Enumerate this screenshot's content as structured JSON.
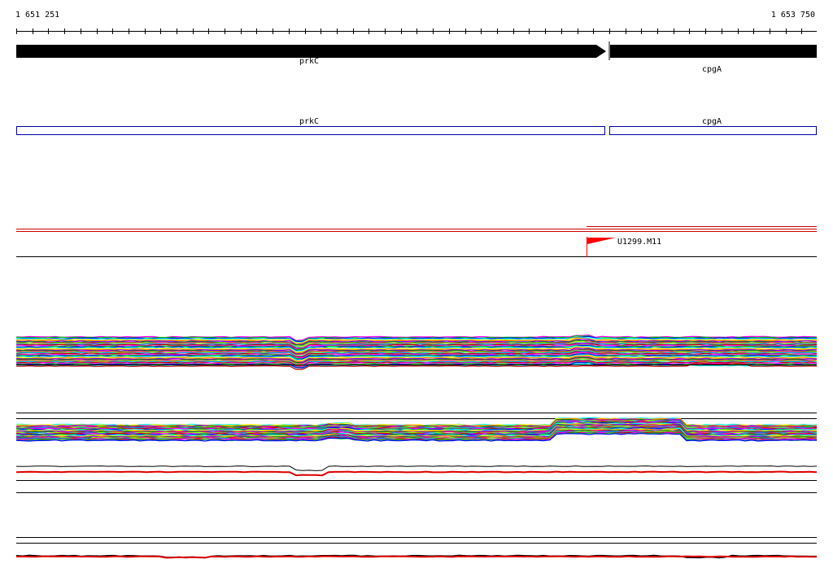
{
  "ruler": {
    "start_label": "1 651 251",
    "end_label": "1 653 750"
  },
  "genes": [
    {
      "name": "prkC",
      "strand": "+"
    },
    {
      "name": "cpgA",
      "strand": "+"
    }
  ],
  "annotation_boxes": [
    {
      "name": "prkC"
    },
    {
      "name": "cpgA"
    }
  ],
  "feature": {
    "label": "U1299.M11",
    "flag_color": "#ff0000"
  },
  "colors": {
    "gene_fill": "#000000",
    "box_stroke": "#0000aa",
    "highlight": "#ff0000"
  },
  "profiles": {
    "palette": [
      "#ff00ff",
      "#00cc00",
      "#0000ff",
      "#00ffff",
      "#ffff00",
      "#ff8800",
      "#8800ff",
      "#008800",
      "#ff0088",
      "#88ff00",
      "#0088ff",
      "#cc0000"
    ]
  }
}
